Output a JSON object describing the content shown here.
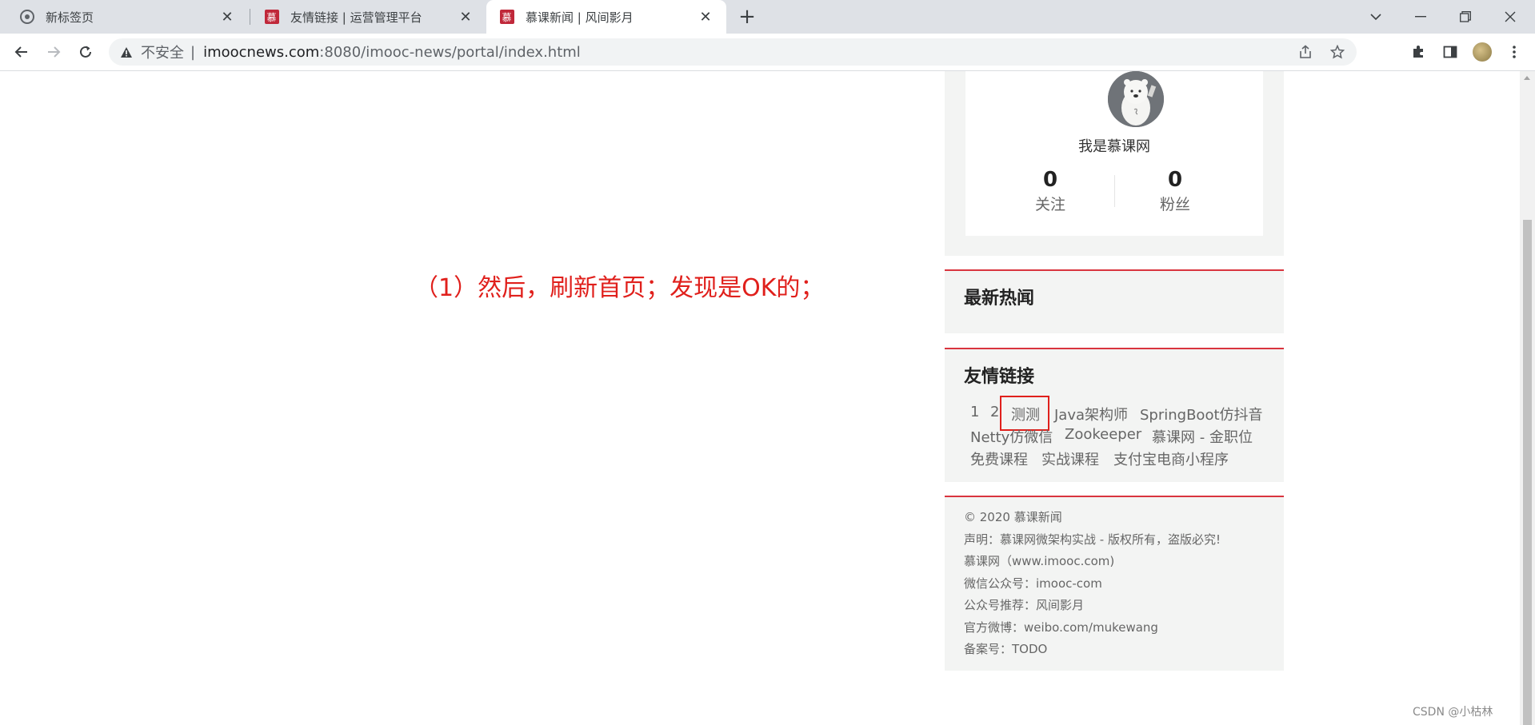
{
  "browser": {
    "tabs": [
      {
        "title": "新标签页",
        "icon": "chrome-icon",
        "active": false
      },
      {
        "title": "友情链接 | 运营管理平台",
        "icon": "imooc-icon",
        "active": false
      },
      {
        "title": "慕课新闻 | 风间影月",
        "icon": "imooc-icon",
        "active": true
      }
    ],
    "favicon_char": "慕",
    "address": {
      "security_label": "不安全",
      "separator": "|",
      "host": "imoocnews.com",
      "path": ":8080/imooc-news/portal/index.html"
    }
  },
  "annotation": "（1）然后，刷新首页；发现是OK的；",
  "profile": {
    "name": "我是慕课网",
    "following_count": "0",
    "following_label": "关注",
    "fans_count": "0",
    "fans_label": "粉丝"
  },
  "hot_news": {
    "title": "最新热闻"
  },
  "friend_links": {
    "title": "友情链接",
    "links": [
      "1",
      "2",
      "测测",
      "Java架构师",
      "SpringBoot仿抖音",
      "Netty仿微信",
      "Zookeeper",
      "慕课网 - 金职位",
      "免费课程",
      "实战课程",
      "支付宝电商小程序"
    ],
    "highlighted": "测测"
  },
  "footer": {
    "lines": [
      "© 2020 慕课新闻",
      "声明：慕课网微架构实战 - 版权所有，盗版必究!",
      "慕课网（www.imooc.com)",
      "微信公众号：imooc-com",
      "公众号推荐：风间影月",
      "官方微博：weibo.com/mukewang",
      "备案号：TODO"
    ]
  },
  "watermark": "CSDN @小枯林",
  "colors": {
    "accent_red": "#d9343e",
    "annotation_red": "#e0201c",
    "panel_bg": "#f3f4f3"
  }
}
